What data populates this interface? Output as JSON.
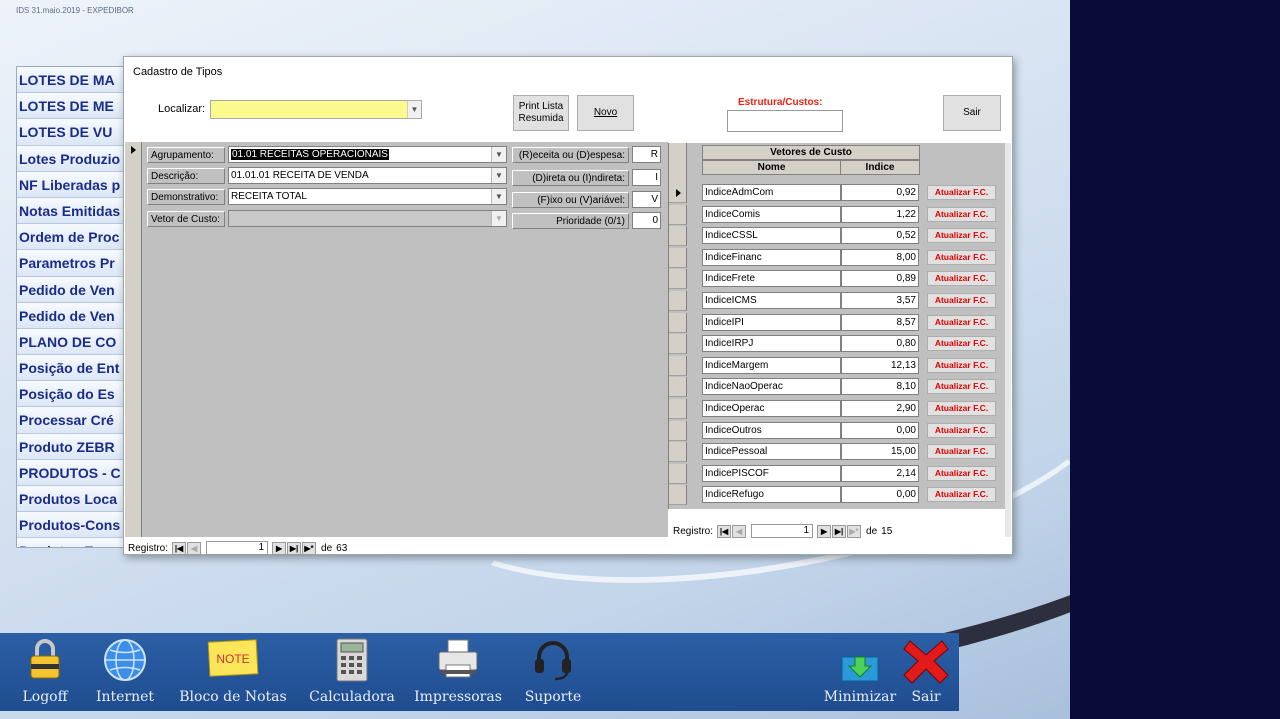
{
  "top_title": "IDS 31.maio.2019  -  EXPEDIBOR",
  "left_menu": [
    "LOTES DE MA",
    "LOTES DE ME",
    "LOTES DE VU",
    "Lotes Produzio",
    "NF Liberadas p",
    "Notas Emitidas",
    "Ordem de Proc",
    "Parametros Pr",
    "Pedido de Ven",
    "Pedido de Ven",
    "PLANO DE CO",
    "Posição de Ent",
    "Posição do Es",
    "Processar Cré",
    "Produto ZEBR",
    "PRODUTOS - C",
    "Produtos Loca",
    "Produtos-Cons",
    "Produtos Encr"
  ],
  "dialog": {
    "title": "Cadastro de Tipos",
    "find_label": "Localizar:",
    "find_value": "",
    "print_button": "Print Lista Resumida",
    "new_button": "Novo",
    "structure_label": "Estrutura/Custos:",
    "structure_value": "",
    "exit_button": "Sair"
  },
  "form": {
    "agrupamento_label": "Agrupamento:",
    "agrupamento_value": "01.01 RECEITAS OPERACIONAIS",
    "descricao_label": "Descrição:",
    "descricao_value": "01.01.01 RECEITA DE VENDA",
    "demonstrativo_label": "Demonstrativo:",
    "demonstrativo_value": "RECEITA TOTAL",
    "vetor_label": "Vetor de Custo:",
    "vetor_value": "",
    "rd_label": "(R)eceita ou (D)espesa:",
    "rd_value": "R",
    "di_label": "(D)ireta  ou (I)ndireta:",
    "di_value": "I",
    "fv_label": "(F)ixo ou (V)ariável:",
    "fv_value": "V",
    "prio_label": "Prioridade (0/1)",
    "prio_value": "0"
  },
  "form_nav": {
    "label": "Registro:",
    "current": "1",
    "total_prefix": "de",
    "total": "63"
  },
  "grid": {
    "title": "Vetores de Custo",
    "col_name": "Nome",
    "col_index": "Indice",
    "button_label": "Atualizar F.C.",
    "rows": [
      {
        "name": "IndiceAdmCom",
        "value": "0,92"
      },
      {
        "name": "IndiceComis",
        "value": "1,22"
      },
      {
        "name": "IndiceCSSL",
        "value": "0,52"
      },
      {
        "name": "IndiceFinanc",
        "value": "8,00"
      },
      {
        "name": "IndiceFrete",
        "value": "0,89"
      },
      {
        "name": "IndiceICMS",
        "value": "3,57"
      },
      {
        "name": "IndiceIPI",
        "value": "8,57"
      },
      {
        "name": "IndiceIRPJ",
        "value": "0,80"
      },
      {
        "name": "IndiceMargem",
        "value": "12,13"
      },
      {
        "name": "IndiceNaoOperac",
        "value": "8,10"
      },
      {
        "name": "IndiceOperac",
        "value": "2,90"
      },
      {
        "name": "IndiceOutros",
        "value": "0,00"
      },
      {
        "name": "IndicePessoal",
        "value": "15,00"
      },
      {
        "name": "IndicePISCOF",
        "value": "2,14"
      },
      {
        "name": "IndiceRefugo",
        "value": "0,00"
      }
    ]
  },
  "grid_nav": {
    "label": "Registro:",
    "current": "1",
    "total_prefix": "de",
    "total": "15"
  },
  "taskbar": [
    {
      "label": "Logoff",
      "icon": "lock-icon"
    },
    {
      "label": "Internet",
      "icon": "globe-icon"
    },
    {
      "label": "Bloco de Notas",
      "icon": "note-icon",
      "icon_text": "NOTE"
    },
    {
      "label": "Calculadora",
      "icon": "calculator-icon"
    },
    {
      "label": "Impressoras",
      "icon": "printer-icon"
    },
    {
      "label": "Suporte",
      "icon": "headset-icon"
    },
    {
      "label": "Minimizar",
      "icon": "minimize-icon"
    },
    {
      "label": "Sair",
      "icon": "close-x-icon"
    }
  ],
  "colors": {
    "accent_red": "#e00000",
    "find_yellow": "#fcfa8c",
    "taskbar_blue": "#2458a0",
    "right_panel": "#0b0b3a"
  }
}
